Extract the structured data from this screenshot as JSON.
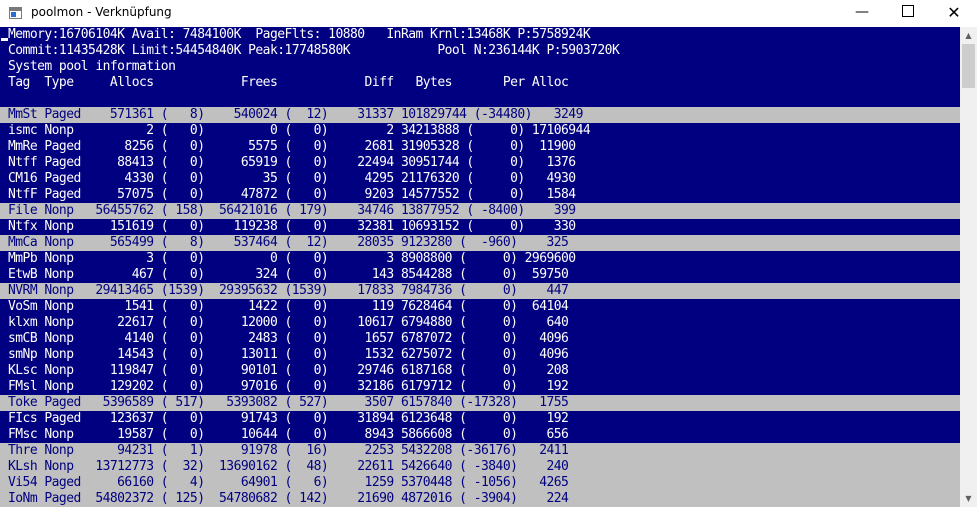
{
  "window": {
    "title": "poolmon - Verknüpfung",
    "minimize_glyph": "—",
    "close_glyph": "✕"
  },
  "scrollbar": {
    "up_glyph": "▲",
    "down_glyph": "▼"
  },
  "console": {
    "lines": [
      "Memory:16706104K Avail: 7484100K  PageFlts: 10880   InRam Krnl:13468K P:5758924K",
      "Commit:11435428K Limit:54454840K Peak:17748580K            Pool N:236144K P:5903720K",
      "System pool information",
      "Tag  Type     Allocs            Frees            Diff   Bytes       Per Alloc",
      "",
      "MmSt Paged    571361 (   8)    540024 (  12)    31337 101829744 (-34480)   3249",
      "ismc Nonp          2 (   0)         0 (   0)        2 34213888 (     0) 17106944",
      "MmRe Paged      8256 (   0)      5575 (   0)     2681 31905328 (     0)  11900",
      "Ntff Paged     88413 (   0)     65919 (   0)    22494 30951744 (     0)   1376",
      "CM16 Paged      4330 (   0)        35 (   0)     4295 21176320 (     0)   4930",
      "NtfF Paged     57075 (   0)     47872 (   0)     9203 14577552 (     0)   1584",
      "File Nonp   56455762 ( 158)  56421016 ( 179)    34746 13877952 ( -8400)    399",
      "Ntfx Nonp     151619 (   0)    119238 (   0)    32381 10693152 (     0)    330",
      "MmCa Nonp     565499 (   8)    537464 (  12)    28035 9123280 (  -960)    325",
      "MmPb Nonp          3 (   0)         0 (   0)        3 8908800 (     0) 2969600",
      "EtwB Nonp        467 (   0)       324 (   0)      143 8544288 (     0)  59750",
      "NVRM Nonp   29413465 (1539)  29395632 (1539)    17833 7984736 (     0)    447",
      "VoSm Nonp       1541 (   0)      1422 (   0)      119 7628464 (     0)  64104",
      "klxm Nonp      22617 (   0)     12000 (   0)    10617 6794880 (     0)    640",
      "smCB Nonp       4140 (   0)      2483 (   0)     1657 6787072 (     0)   4096",
      "smNp Nonp      14543 (   0)     13011 (   0)     1532 6275072 (     0)   4096",
      "KLsc Nonp     119847 (   0)     90101 (   0)    29746 6187168 (     0)    208",
      "FMsl Nonp     129202 (   0)     97016 (   0)    32186 6179712 (     0)    192",
      "Toke Paged   5396589 ( 517)   5393082 ( 527)     3507 6157840 (-17328)   1755",
      "FIcs Paged    123637 (   0)     91743 (   0)    31894 6123648 (     0)    192",
      "FMsc Nonp      19587 (   0)     10644 (   0)     8943 5866608 (     0)    656",
      "Thre Nonp      94231 (   1)     91978 (  16)     2253 5432208 (-36176)   2411",
      "KLsh Nonp   13712773 (  32)  13690162 (  48)    22611 5426640 ( -3840)    240",
      "Vi54 Paged     66160 (   4)     64901 (   6)     1259 5370448 ( -1056)   4265",
      "IoNm Paged  54802372 ( 125)  54780682 ( 142)    21690 4872016 ( -3904)    224"
    ],
    "highlighted_rows": [
      5,
      11,
      13,
      16,
      23,
      26,
      27,
      28,
      29
    ]
  }
}
